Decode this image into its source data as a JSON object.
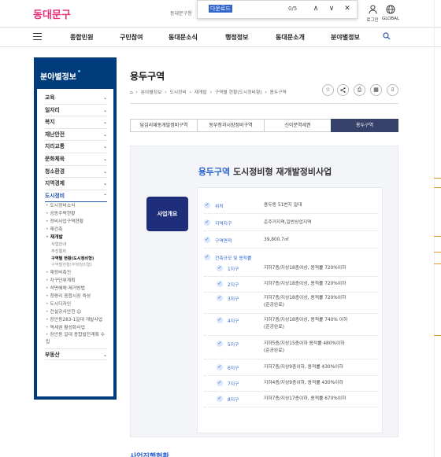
{
  "header": {
    "logo": "동대문구",
    "site_label": "동대문구청",
    "find": {
      "query": "다운로드",
      "count": "0/5",
      "prev": "∧",
      "next": "∨",
      "close": "✕"
    },
    "utils": [
      {
        "label": "로그인"
      },
      {
        "label": "GLOBAL"
      }
    ]
  },
  "gnb": {
    "items": [
      "종합민원",
      "구민참여",
      "동대문소식",
      "행정정보",
      "동대문소개",
      "분야별정보"
    ]
  },
  "sidebar": {
    "title": "분야별정보",
    "level1_top": [
      {
        "label": "교육"
      },
      {
        "label": "일자리"
      },
      {
        "label": "복지"
      },
      {
        "label": "재난안전"
      },
      {
        "label": "지리교통"
      },
      {
        "label": "문화체육"
      },
      {
        "label": "청소환경"
      },
      {
        "label": "지역경제"
      }
    ],
    "open_item": "도시정비",
    "sub_a": [
      "도시정비소식",
      "공동주택현황",
      "정비사업구역현황",
      "재건축"
    ],
    "sub_b_head": "재개발",
    "sub_c": [
      "사업안내",
      "추진절차",
      "구역별 현황(도시정비형)",
      "구역별현황(주택정비형)"
    ],
    "sub_d": [
      "재정비촉진",
      "지구단위계획",
      "석면해체·제거방법",
      "청량리 종합시장 육성",
      "도시디자인",
      "건설공사안전 ☺",
      "장안동283-1일대 개발사업",
      "역세권 활성화사업"
    ],
    "sub_wrap": "장안동 일대 종합발전계획 수립",
    "last_item": "부동산"
  },
  "main": {
    "title": "용두구역",
    "breadcrumb": [
      "⌂",
      "분야별정보",
      "도시정비",
      "재개발",
      "구역별 현황(도시정비형)",
      "용두구역"
    ],
    "tabs": [
      "답십리재동개발정비구역",
      "동부청과시장정비구역",
      "신이문역세권",
      "용두구역"
    ],
    "panel_title_hl": "용두구역",
    "panel_title_rest": "도시정비형 재개발정비사업",
    "badge": "사업개요",
    "rows": [
      {
        "label": "위치",
        "value": "용두동 51번지 일대"
      },
      {
        "label": "지역지구",
        "value": "준주거지역,일반상업지역"
      },
      {
        "label": "구역면적",
        "value": "39,800.7㎡"
      },
      {
        "label": "건축규모 및 용적률",
        "value": ""
      }
    ],
    "districts": [
      {
        "label": "1지구",
        "value": "지하7층/지상18층이상, 용적률 720%이하"
      },
      {
        "label": "2지구",
        "value": "지하7층/지상18층이상, 용적률 720%이하"
      },
      {
        "label": "3지구",
        "value": "지하7층/지상18층이상, 용적률 720%이하",
        "extra": "(준공완료)"
      },
      {
        "label": "4지구",
        "value": "지하7층/지상18층이상, 용적률 740% 이하",
        "extra": "(준공완료)"
      },
      {
        "label": "5지구",
        "value": "지하5층/지상15층이하 용적률 480%이하",
        "extra": "(준공완료)"
      },
      {
        "label": "6지구",
        "value": "지하7층/지상9층이하, 용적률 430%이하"
      },
      {
        "label": "7지구",
        "value": "지하4층/지상9층이하, 용적률 430%이하"
      },
      {
        "label": "8지구",
        "value": "지하7층/지상17층이하, 용적률 670%이하"
      }
    ],
    "next_section": "사업진행현황"
  },
  "colors": {
    "primary": "#003b7c",
    "accent": "#2d63d0",
    "tab_active": "#36426a",
    "logo": "#e5337a"
  }
}
